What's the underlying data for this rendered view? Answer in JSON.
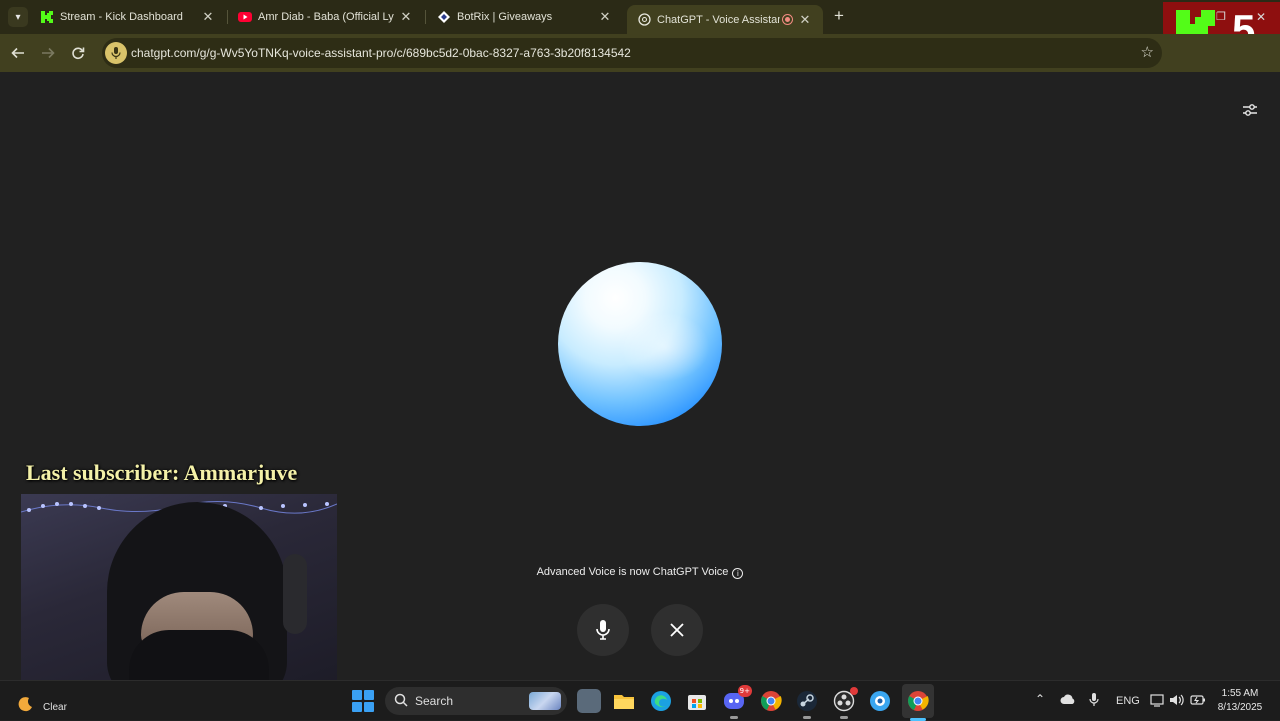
{
  "browser": {
    "tabs": [
      {
        "title": "Stream - Kick Dashboard",
        "favicon": "kick-icon",
        "active": false
      },
      {
        "title": "Amr Diab - Baba (Official Lyric V",
        "favicon": "youtube-icon",
        "active": false
      },
      {
        "title": "BotRix | Giveaways",
        "favicon": "botrix-icon",
        "active": false
      },
      {
        "title": "ChatGPT - Voice Assistant P",
        "favicon": "chatgpt-icon",
        "active": true,
        "recording": true
      }
    ],
    "url": "chatgpt.com/g/g-Wv5YoTNKq-voice-assistant-pro/c/689bc5d2-0bac-8327-a763-3b20f8134542"
  },
  "overlay": {
    "kick_badge_count": "5",
    "last_subscriber": "Last subscriber: Ammarjuve"
  },
  "voice": {
    "notice": "Advanced Voice is now ChatGPT Voice",
    "mic_button": "microphone-icon",
    "close_button": "close-icon"
  },
  "taskbar": {
    "weather": "Clear",
    "search_label": "Search",
    "discord_badge": "9+",
    "tray_language": "ENG",
    "time": "1:55 AM",
    "date": "8/13/2025"
  },
  "colors": {
    "tab_strip": "#2b2a16",
    "toolbar": "#41401f",
    "content_bg": "#212121",
    "orb_accent": "#2d95ff",
    "subscriber_text": "#f4f1a8",
    "kick_green": "#53fc18"
  }
}
